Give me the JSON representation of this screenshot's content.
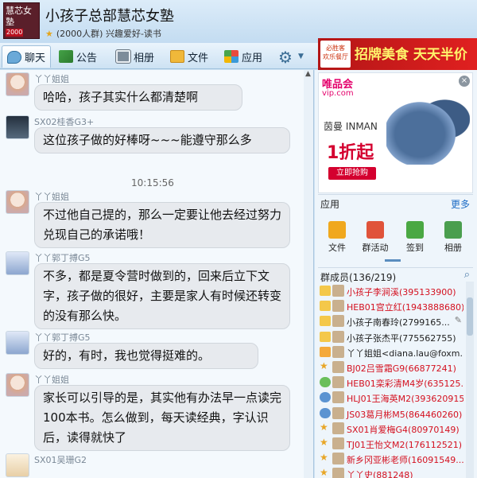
{
  "header": {
    "logo_text": "慧芯女塾",
    "logo_tag": "2000",
    "title": "小孩子总部慧芯女塾",
    "subtitle": "(2000人群) 兴趣爱好-读书"
  },
  "toolbar": {
    "tabs": [
      {
        "label": "聊天",
        "icon": "chat-bubble-icon"
      },
      {
        "label": "公告",
        "icon": "megaphone-icon"
      },
      {
        "label": "相册",
        "icon": "photo-icon"
      },
      {
        "label": "文件",
        "icon": "folder-icon"
      },
      {
        "label": "应用",
        "icon": "apps-grid-icon"
      }
    ],
    "settings_icon": "gear-icon"
  },
  "top_banner": {
    "logo": "必胜客",
    "logo_sub": "欢乐餐厅",
    "text": "招牌美食 天天半价"
  },
  "chat": {
    "timestamp": "10:15:56",
    "messages": [
      {
        "sender": "丫丫姐姐",
        "text": "哈哈，孩子其实什么都清楚啊"
      },
      {
        "sender": "SX02桂香G3+",
        "text": "这位孩子做的好棒呀~~~能遵守那么多"
      },
      {
        "sender": "丫丫姐姐",
        "text": "不过他自己提的，那么一定要让他去经过努力兑现自己的承诺哦！"
      },
      {
        "sender": "丫丫郭丁搏G5",
        "text": "不多，都是夏令营时做到的，回来后立下文字，孩子做的很好，主要是家人有时候还转变的没有那么快。"
      },
      {
        "sender": "丫丫郭丁搏G5",
        "text": "好的，有时，我也觉得挺难的。"
      },
      {
        "sender": "丫丫姐姐",
        "text": "家长可以引导的是，其实他有办法早一点读完100本书。怎么做到，每天读经典，字认识后，读得就快了"
      },
      {
        "sender": "SX01吴珊G2",
        "text": ""
      }
    ]
  },
  "ad": {
    "brand": "唯品会",
    "site": "vip.com",
    "product_brand": "茵曼 INMAN",
    "discount": "1折起",
    "buy_label": "立即抢购"
  },
  "apps": {
    "title": "应用",
    "more": "更多",
    "items": [
      {
        "label": "文件"
      },
      {
        "label": "群活动"
      },
      {
        "label": "签到"
      },
      {
        "label": "相册"
      }
    ]
  },
  "members": {
    "title": "群成员(136/219)",
    "list": [
      {
        "name": "小孩子李涧溪(395133900)",
        "color": "red"
      },
      {
        "name": "HEB01宫立红(1943888680)",
        "color": "red"
      },
      {
        "name": "小孩子南春玲(2799165...",
        "color": "black"
      },
      {
        "name": "小孩子张杰平(775562755)",
        "color": "black"
      },
      {
        "name": "丫丫姐姐<diana.lau@foxm...",
        "color": "black"
      },
      {
        "name": "BJ02吕雪霜G9(66877241)",
        "color": "red"
      },
      {
        "name": "HEB01栾彩清M4岁(635125...",
        "color": "red"
      },
      {
        "name": "HLJ01王海英M2(393620915)",
        "color": "red"
      },
      {
        "name": "JS03葛月彬M5(864460260)",
        "color": "red"
      },
      {
        "name": "SX01肖爱梅G4(80970149)",
        "color": "red"
      },
      {
        "name": "TJ01王怡文M2(176112521)",
        "color": "red"
      },
      {
        "name": "新乡冈亚彬老师(16091549...",
        "color": "red"
      },
      {
        "name": "丫丫史(881248)",
        "color": "red"
      }
    ]
  }
}
